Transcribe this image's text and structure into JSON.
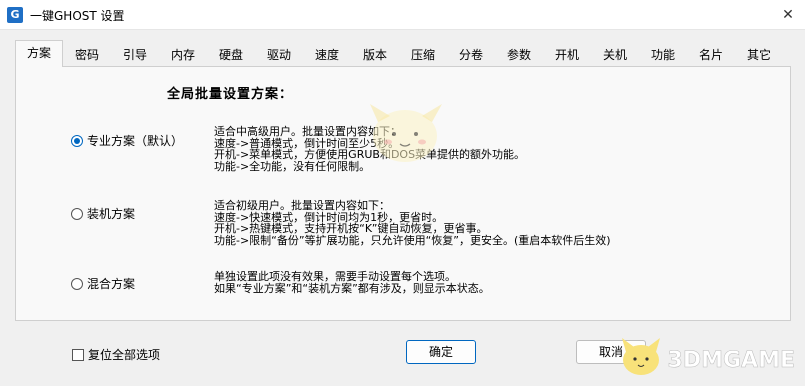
{
  "window": {
    "title": "一键GHOST 设置",
    "app_icon": "G"
  },
  "tabs": [
    {
      "label": "方案",
      "active": true
    },
    {
      "label": "密码"
    },
    {
      "label": "引导"
    },
    {
      "label": "内存"
    },
    {
      "label": "硬盘"
    },
    {
      "label": "驱动"
    },
    {
      "label": "速度"
    },
    {
      "label": "版本"
    },
    {
      "label": "压缩"
    },
    {
      "label": "分卷"
    },
    {
      "label": "参数"
    },
    {
      "label": "开机"
    },
    {
      "label": "关机"
    },
    {
      "label": "功能"
    },
    {
      "label": "名片"
    },
    {
      "label": "其它"
    }
  ],
  "panel": {
    "title": "全局批量设置方案：",
    "options": [
      {
        "label": "专业方案（默认）",
        "checked": true,
        "desc": [
          "适合中高级用户。批量设置内容如下：",
          "速度->普通模式，倒计时间至少5秒。",
          "开机->菜单模式，方便使用GRUB和DOS菜单提供的额外功能。",
          "功能->全功能，没有任何限制。"
        ]
      },
      {
        "label": "装机方案",
        "checked": false,
        "desc": [
          "适合初级用户。批量设置内容如下：",
          "速度->快速模式，倒计时间均为1秒，更省时。",
          "开机->热键模式，支持开机按“K”键自动恢复，更省事。",
          "功能->限制“备份”等扩展功能，只允许使用“恢复”，更安全。(重启本软件后生效)"
        ]
      },
      {
        "label": "混合方案",
        "checked": false,
        "desc": [
          "单独设置此项没有效果，需要手动设置每个选项。",
          "如果“专业方案”和“装机方案”都有涉及，则显示本状态。"
        ]
      }
    ]
  },
  "footer": {
    "reset_label": "复位全部选项",
    "ok_label": "确定",
    "cancel_label": "取消"
  },
  "watermark": "3DMGAME",
  "colors": {
    "accent": "#0067c0",
    "panel_bg": "#f9f9f9",
    "window_bg": "#f0f0f0"
  }
}
